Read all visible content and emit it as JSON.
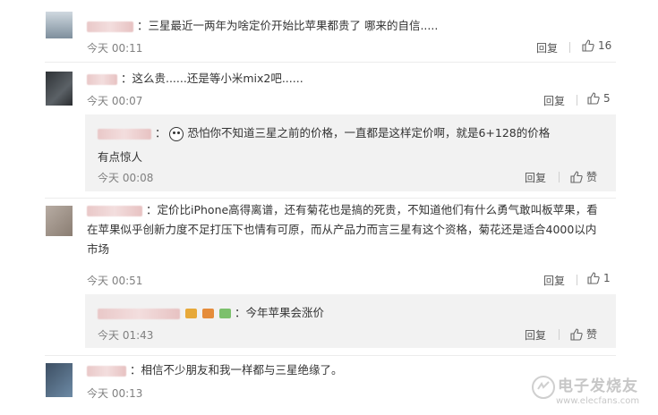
{
  "comments": [
    {
      "text": "：三星最近一两年为啥定价开始比苹果都贵了  哪来的自信.....",
      "time": "今天 00:11",
      "reply_label": "回复",
      "like_count": "16"
    },
    {
      "text": "：这么贵......还是等小米mix2吧......",
      "time": "今天 00:07",
      "reply_label": "回复",
      "like_count": "5",
      "sub": {
        "text_1": "：",
        "text_2": "恐怕你不知道三星之前的价格，一直都是这样定价啊，就是6+128的价格",
        "text_3": "有点惊人",
        "time": "今天 00:08",
        "reply_label": "回复",
        "like_label": "赞"
      }
    },
    {
      "text": "：定价比iPhone高得离谱，还有菊花也是搞的死贵，不知道他们有什么勇气敢叫板苹果，看在苹果似乎创新力度不足打压下也情有可原，而从产品力而言三星有这个资格，菊花还是适合4000以内市场",
      "time": "今天 00:51",
      "reply_label": "回复",
      "like_count": "1",
      "sub": {
        "text": "：今年苹果会涨价",
        "time": "今天 01:43",
        "reply_label": "回复",
        "like_label": "赞"
      }
    },
    {
      "text": "：相信不少朋友和我一样都与三星绝缘了。",
      "time": "今天 00:13"
    }
  ],
  "watermark": {
    "title": "电子发烧友",
    "subtitle": "www.elecfans.com"
  },
  "colors": {
    "sub_bg": "#f2f2f2",
    "time": "#808080",
    "divider": "#ececec"
  }
}
